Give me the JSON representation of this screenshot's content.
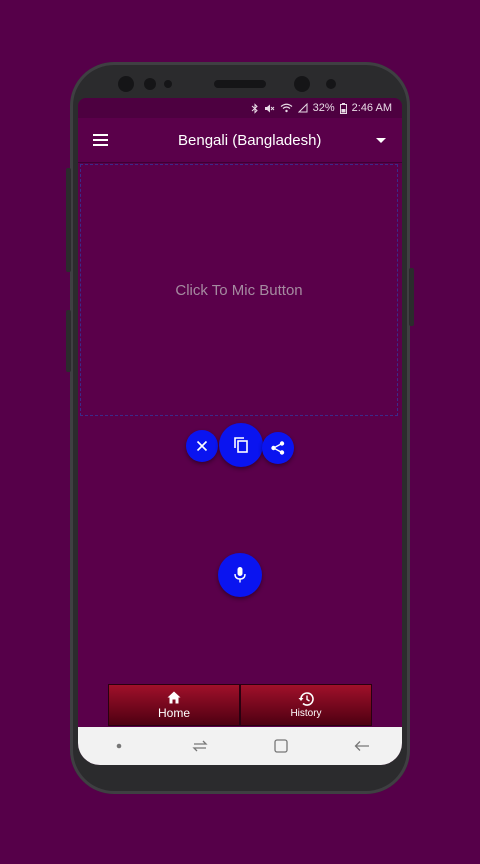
{
  "status_bar": {
    "battery": "32%",
    "time": "2:46 AM",
    "icons": [
      "bluetooth-icon",
      "mute-icon",
      "wifi-icon",
      "signal-icon",
      "battery-icon"
    ]
  },
  "app_bar": {
    "menu_icon": "hamburger-menu-icon",
    "language": "Bengali (Bangladesh)",
    "dropdown_icon": "caret-down-icon"
  },
  "main": {
    "placeholder": "Click To Mic Button",
    "actions": [
      "close-icon",
      "copy-icon",
      "share-icon"
    ],
    "mic_icon": "mic-icon"
  },
  "bottom_nav": {
    "items": [
      {
        "label": "Home",
        "icon": "home-icon"
      },
      {
        "label": "History",
        "icon": "history-icon"
      }
    ]
  },
  "colors": {
    "background": "#560049",
    "fab": "#0a14f0",
    "nav": "#8a0b24"
  }
}
